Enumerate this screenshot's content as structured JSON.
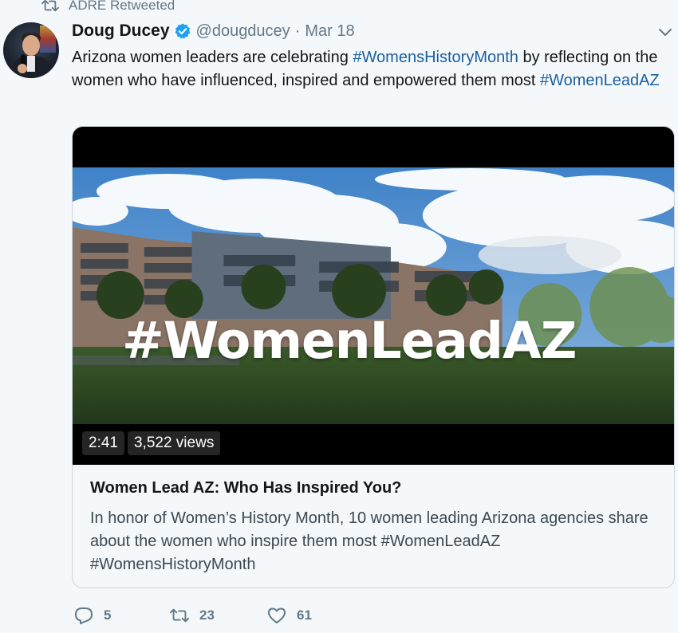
{
  "retweet_context": {
    "label": "ADRE Retweeted"
  },
  "tweet": {
    "author_name": "Doug Ducey",
    "handle": "@dougducey",
    "separator": "·",
    "date": "Mar 18",
    "text": {
      "part1": "Arizona women leaders are celebrating ",
      "hashtag1": "#WomensHistoryMonth",
      "part2": " by reflecting on the women who have influenced, inspired and empowered them most ",
      "hashtag2": "#WomenLeadAZ"
    }
  },
  "card": {
    "video_overlay_text": "#WomenLeadAZ",
    "duration": "2:41",
    "views": "3,522 views",
    "title": "Women Lead AZ: Who Has Inspired You?",
    "description": "In honor of Women’s History Month, 10 women leading Arizona agencies share about the women who inspire them most #WomenLeadAZ #WomensHistoryMonth"
  },
  "actions": {
    "replies": "5",
    "retweets": "23",
    "likes": "61"
  },
  "icons": {
    "retweet_context": "retweet-icon",
    "verified": "verified-badge-icon",
    "caret": "chevron-down-icon",
    "reply": "reply-icon",
    "retweet": "retweet-icon",
    "like": "heart-icon"
  },
  "colors": {
    "background": "#f4f8fa",
    "text": "#14171a",
    "secondary": "#657786",
    "hashtag": "#1b5fa0",
    "verified": "#1da1f2"
  }
}
